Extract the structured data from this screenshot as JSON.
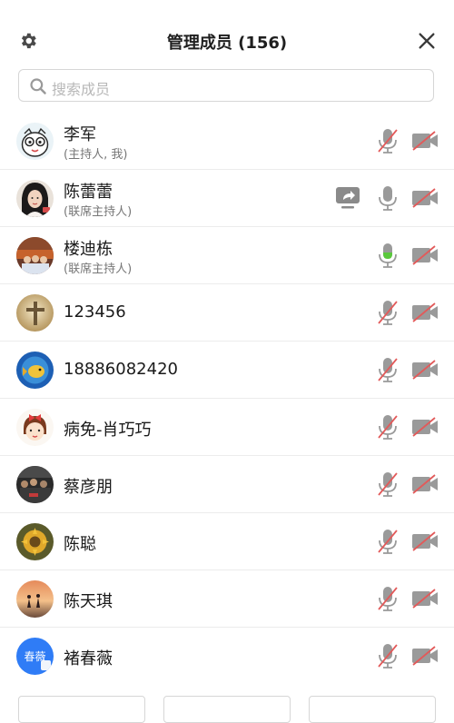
{
  "header": {
    "title": "管理成员 (156)",
    "settings_icon": "gear-icon",
    "close_icon": "close-icon"
  },
  "search": {
    "placeholder": "搜索成员",
    "icon": "search-icon"
  },
  "colors": {
    "muted_red": "#e25a5a",
    "mic_active_green": "#5ac83c",
    "icon_gray": "#8a8a8a",
    "divider": "#ececec"
  },
  "members": [
    {
      "name": "李军",
      "role": "(主持人, 我)",
      "mic": "muted",
      "camera": "off",
      "sharing": false,
      "avatar": "cartoon-owl"
    },
    {
      "name": "陈蕾蕾",
      "role": "(联席主持人)",
      "mic": "on",
      "camera": "off",
      "sharing": true,
      "avatar": "photo-portrait"
    },
    {
      "name": "楼迪栋",
      "role": "(联席主持人)",
      "mic": "speaking",
      "camera": "off",
      "sharing": false,
      "avatar": "photo-group"
    },
    {
      "name": "123456",
      "role": "",
      "mic": "muted",
      "camera": "off",
      "sharing": false,
      "avatar": "photo-cross"
    },
    {
      "name": "18886082420",
      "role": "",
      "mic": "muted",
      "camera": "off",
      "sharing": false,
      "avatar": "photo-fish"
    },
    {
      "name": "病免-肖巧巧",
      "role": "",
      "mic": "muted",
      "camera": "off",
      "sharing": false,
      "avatar": "cartoon-girl"
    },
    {
      "name": "蔡彦朋",
      "role": "",
      "mic": "muted",
      "camera": "off",
      "sharing": false,
      "avatar": "photo-crowd"
    },
    {
      "name": "陈聪",
      "role": "",
      "mic": "muted",
      "camera": "off",
      "sharing": false,
      "avatar": "photo-sunflower"
    },
    {
      "name": "陈天琪",
      "role": "",
      "mic": "muted",
      "camera": "off",
      "sharing": false,
      "avatar": "photo-sunset"
    },
    {
      "name": "褚春薇",
      "role": "",
      "mic": "muted",
      "camera": "off",
      "sharing": false,
      "avatar": "text-avatar",
      "avatar_text": "春薇"
    }
  ]
}
